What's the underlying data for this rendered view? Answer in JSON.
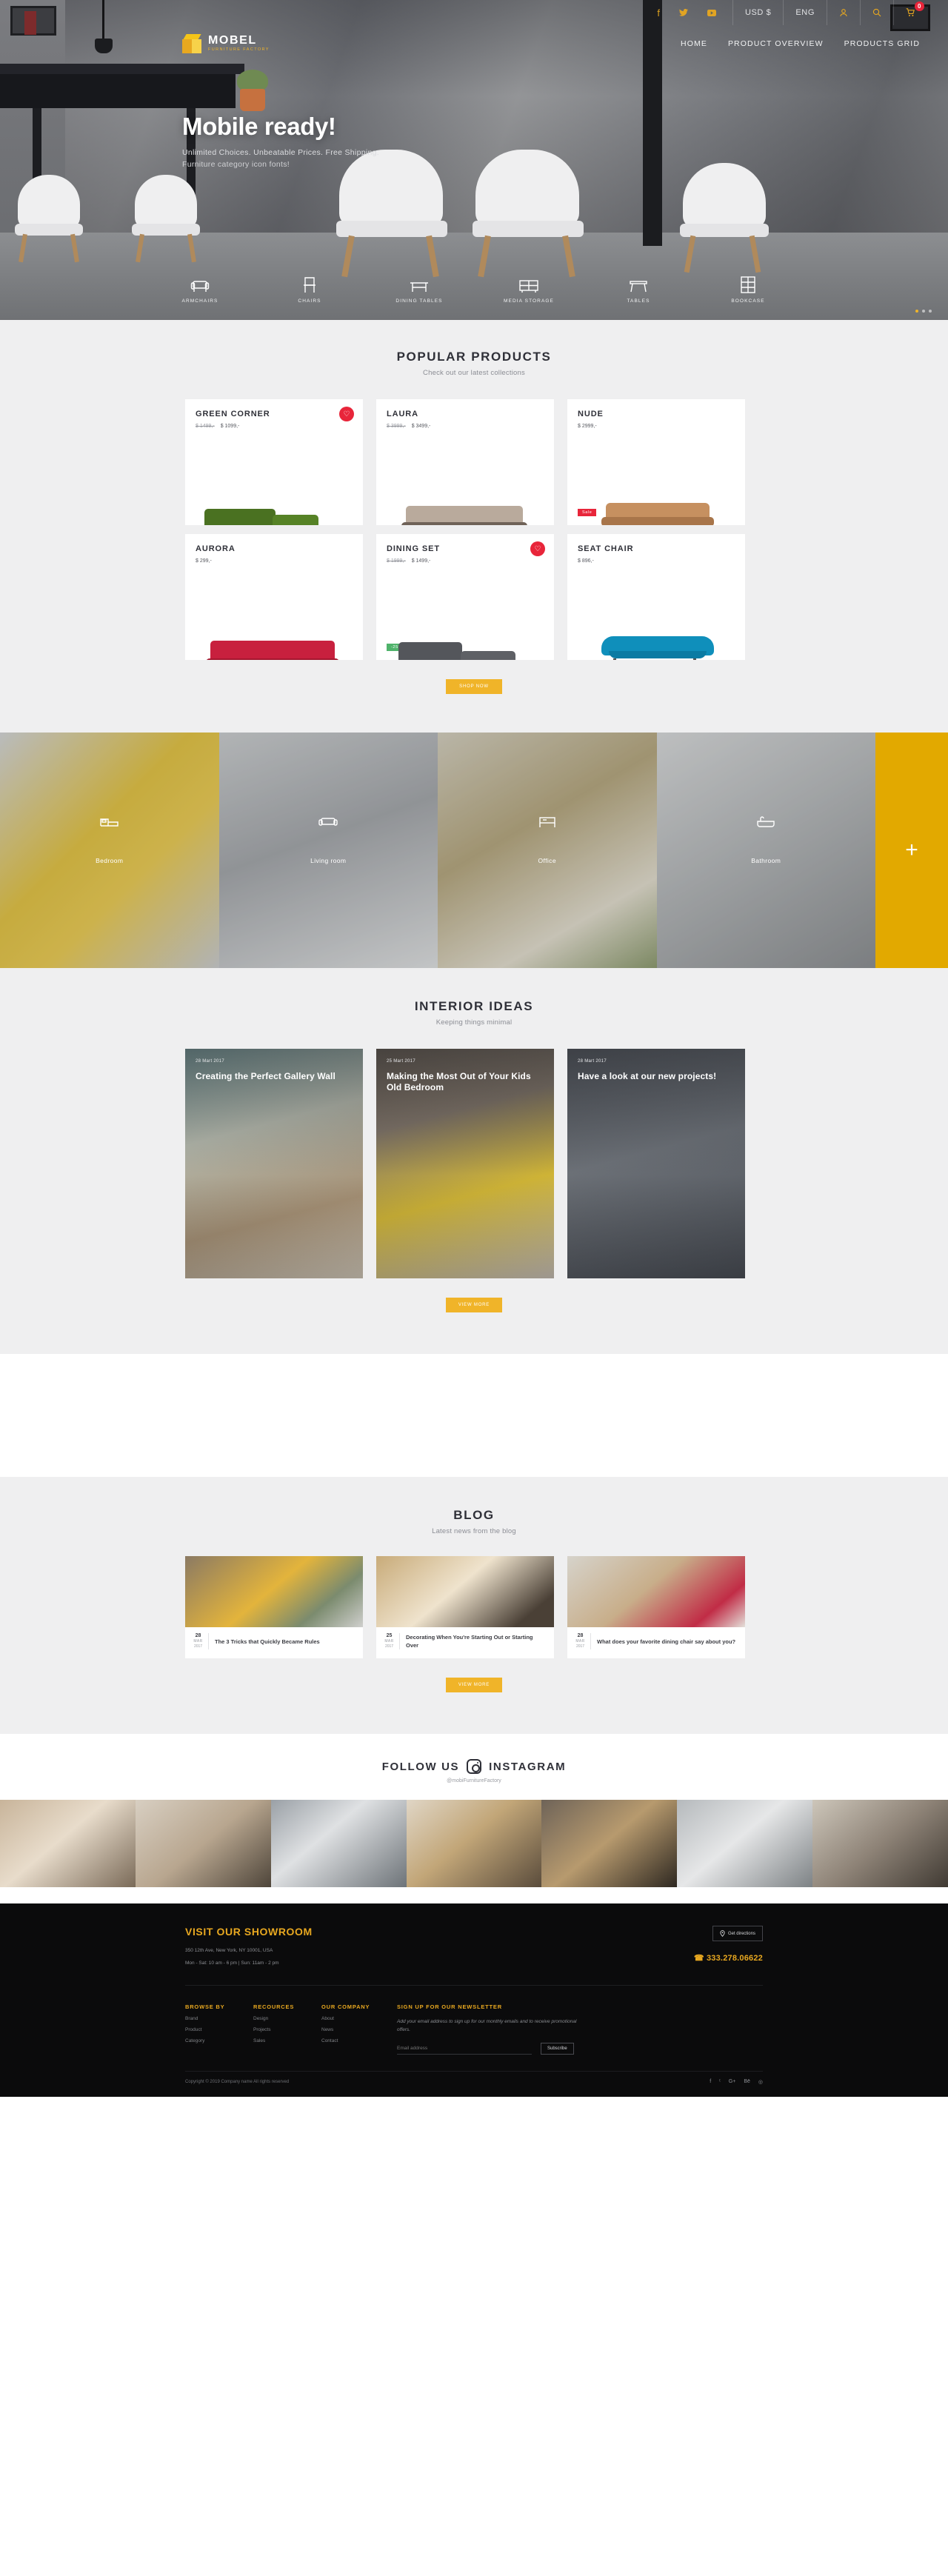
{
  "topbar": {
    "social": [
      {
        "name": "facebook-icon",
        "glyph": "f"
      },
      {
        "name": "twitter-icon",
        "glyph": "ᵗ"
      },
      {
        "name": "youtube-icon",
        "glyph": "▶"
      }
    ],
    "currency": "USD $",
    "language": "ENG",
    "account_icon": "user-icon",
    "search_icon": "search-icon",
    "cart_icon": "cart-icon",
    "cart_count": "0"
  },
  "brand": {
    "name": "MOBEL",
    "tagline": "FURNITURE FACTORY"
  },
  "nav": [
    {
      "label": "HOME"
    },
    {
      "label": "PRODUCT OVERVIEW"
    },
    {
      "label": "PRODUCTS GRID"
    }
  ],
  "hero": {
    "title": "Mobile ready!",
    "subtitle": "Unlimited Choices. Unbeatable Prices. Free Shipping.",
    "subtitle2": "Furniture category icon fonts!",
    "categories": [
      {
        "label": "ARMCHAIRS",
        "icon": "armchair-icon"
      },
      {
        "label": "CHAIRS",
        "icon": "chair-icon"
      },
      {
        "label": "DINING TABLES",
        "icon": "dining-table-icon"
      },
      {
        "label": "MEDIA STORAGE",
        "icon": "media-storage-icon"
      },
      {
        "label": "TABLES",
        "icon": "table-icon"
      },
      {
        "label": "BOOKCASE",
        "icon": "bookcase-icon"
      }
    ]
  },
  "popular": {
    "title": "POPULAR PRODUCTS",
    "subtitle": "Check out our latest collections",
    "button": "Shop now",
    "products": [
      {
        "name": "GREEN CORNER",
        "old_price": "$ 1499,-",
        "price": "$ 1099,-",
        "favorite": true,
        "tag": "",
        "color": "#3f5f1e"
      },
      {
        "name": "LAURA",
        "old_price": "$ 3999,-",
        "price": "$ 3499,-",
        "favorite": false,
        "tag": "",
        "color": "#b8a99b"
      },
      {
        "name": "NUDE",
        "old_price": "",
        "price": "$ 2999,-",
        "favorite": false,
        "tag": "Sale",
        "color": "#c69060"
      },
      {
        "name": "AURORA",
        "old_price": "",
        "price": "$ 299,-",
        "favorite": false,
        "tag": "",
        "color": "#c8203e"
      },
      {
        "name": "DINING SET",
        "old_price": "$ 1999,-",
        "price": "$ 1499,-",
        "favorite": true,
        "tag": "-25%",
        "color": "#5a5c60"
      },
      {
        "name": "SEAT CHAIR",
        "old_price": "",
        "price": "$ 896,-",
        "favorite": false,
        "tag": "",
        "color": "#0f8fbb"
      }
    ]
  },
  "rooms": {
    "items": [
      {
        "label": "Bedroom",
        "icon": "bed-icon"
      },
      {
        "label": "Living room",
        "icon": "sofa-icon"
      },
      {
        "label": "Office",
        "icon": "office-desk-icon"
      },
      {
        "label": "Bathroom",
        "icon": "bathtub-icon"
      }
    ],
    "more": "+"
  },
  "ideas": {
    "title": "INTERIOR IDEAS",
    "subtitle": "Keeping things minimal",
    "button": "View more",
    "cards": [
      {
        "date": "28 Mart 2017",
        "title": "Creating the Perfect Gallery Wall"
      },
      {
        "date": "25 Mart 2017",
        "title": "Making the Most Out of Your Kids Old Bedroom"
      },
      {
        "date": "28 Mart 2017",
        "title": "Have a look at our new projects!"
      }
    ]
  },
  "blog": {
    "title": "BLOG",
    "subtitle": "Latest news from the blog",
    "button": "View more",
    "posts": [
      {
        "day": "28",
        "month": "MAR",
        "year": "2017",
        "title": "The 3 Tricks that Quickly Became Rules"
      },
      {
        "day": "25",
        "month": "MAR",
        "year": "2017",
        "title": "Decorating When You're Starting Out or Starting Over"
      },
      {
        "day": "28",
        "month": "MAR",
        "year": "2017",
        "title": "What does your favorite dining chair say about you?"
      }
    ]
  },
  "instagram": {
    "follow_word": "FOLLOW US",
    "brand_word": "INSTAGRAM",
    "icon": "instagram-icon",
    "handle": "@mobiFurnitureFactory"
  },
  "footer": {
    "showroom_title": "VISIT OUR SHOWROOM",
    "address": "350 12th Ave, New York, NY 10001, USA",
    "hours": "Mon - Sat: 10 am - 6 pm    |    Sun: 11am - 2 pm",
    "directions_button": "Get directions",
    "directions_icon": "pin-icon",
    "phone": "333.278.06622",
    "phone_icon": "phone-icon",
    "columns": [
      {
        "title": "BROWSE BY",
        "items": [
          "Brand",
          "Product",
          "Category"
        ]
      },
      {
        "title": "RECOURCES",
        "items": [
          "Design",
          "Projects",
          "Sales"
        ]
      },
      {
        "title": "OUR COMPANY",
        "items": [
          "About",
          "News",
          "Contact"
        ]
      }
    ],
    "newsletter": {
      "title": "SIGN UP FOR OUR NEWSLETTER",
      "description": "Add your email address to sign up for our monthly emails and to receive promotional offers.",
      "placeholder": "Email address",
      "button": "Subscribe"
    },
    "copyright": "Copyright © 2019 Company name All rights reserved",
    "socials": [
      {
        "name": "facebook-icon",
        "glyph": "f"
      },
      {
        "name": "twitter-icon",
        "glyph": "ᵗ"
      },
      {
        "name": "google-plus-icon",
        "glyph": "G+"
      },
      {
        "name": "behance-icon",
        "glyph": "Bē"
      },
      {
        "name": "instagram-icon",
        "glyph": "◎"
      }
    ]
  },
  "colors": {
    "accent": "#f0b429",
    "danger": "#e8253a",
    "dark": "#0b0b0c",
    "muted": "#efeff0"
  }
}
